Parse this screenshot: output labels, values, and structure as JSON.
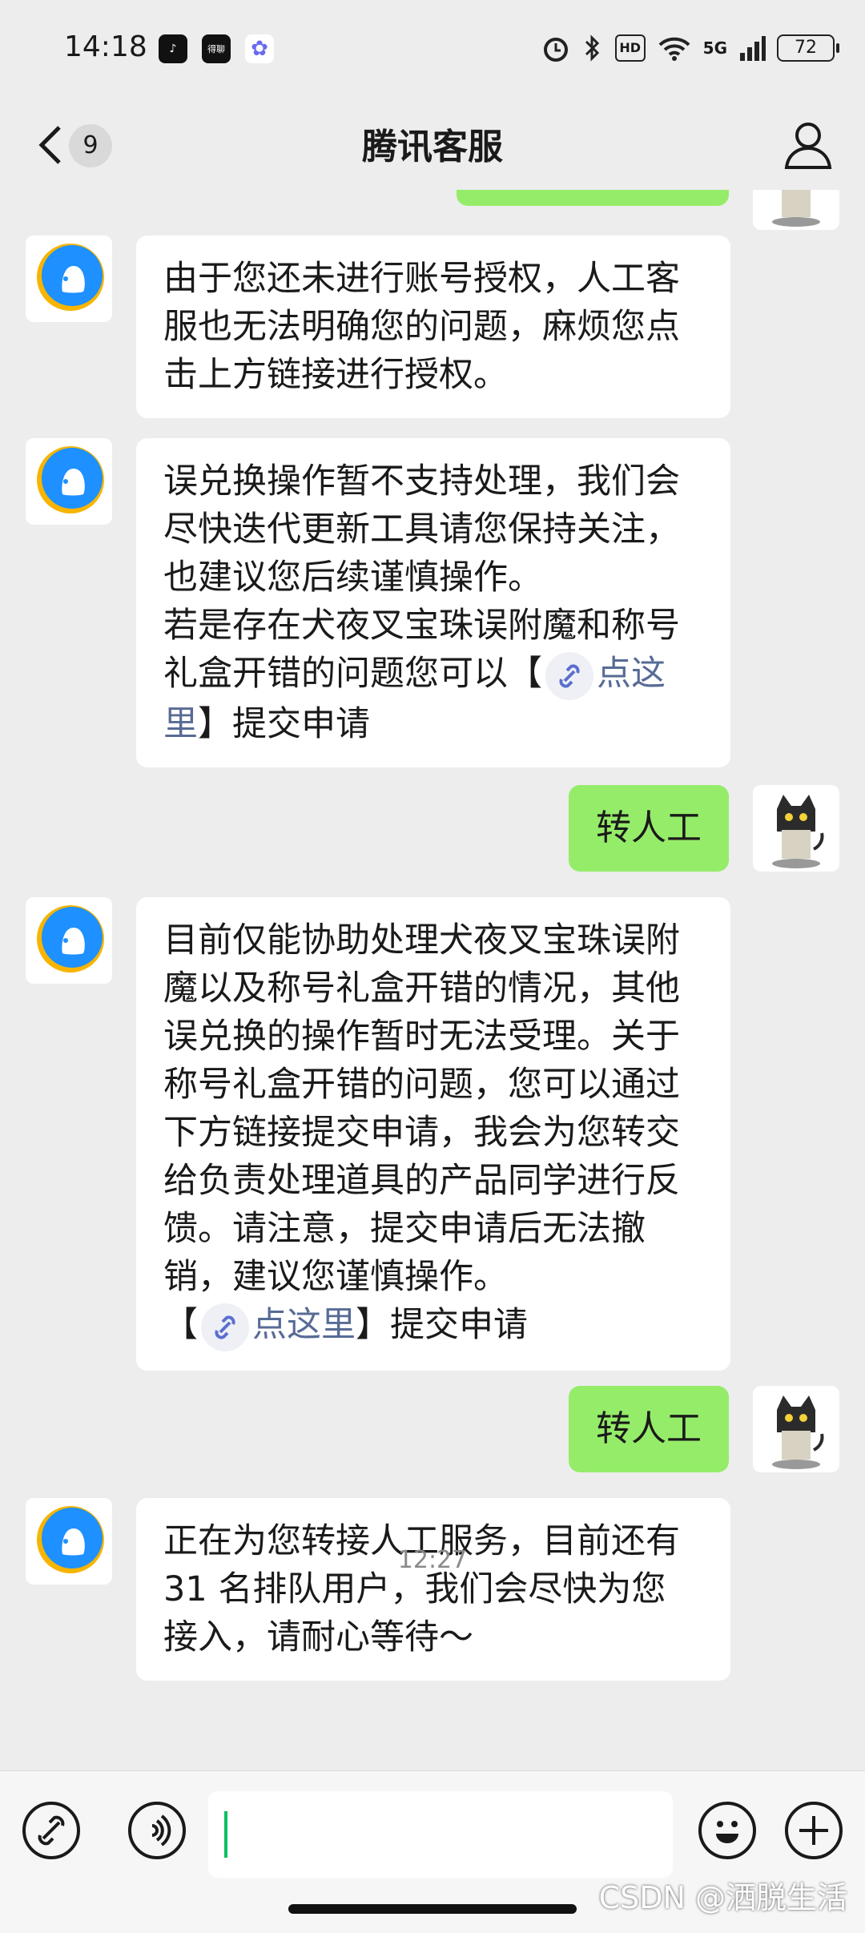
{
  "status": {
    "time": "14:18",
    "app_badges": [
      "♪",
      "得聊",
      "✿"
    ],
    "hd": "HD",
    "network": "5G",
    "battery": "72"
  },
  "header": {
    "back_count": "9",
    "title": "腾讯客服"
  },
  "messages": [
    {
      "from": "bot",
      "lines": [
        "由于您还未进行账号授权，人工客",
        "服也无法明确您的问题，麻烦您点",
        "击上方链接进行授权。"
      ]
    },
    {
      "from": "bot",
      "lines": [
        "误兑换操作暂不支持处理，我们会",
        "尽快迭代更新工具请您保持关注，",
        "也建议您后续谨慎操作。",
        "若是存在犬夜叉宝珠误附魔和称号"
      ],
      "link_prefix": "礼盒开错的问题您可以【",
      "link_text_1": "点这",
      "link_text_2": "里",
      "link_suffix": "】提交申请"
    },
    {
      "from": "user",
      "text": "转人工"
    },
    {
      "from": "bot",
      "lines": [
        "目前仅能协助处理犬夜叉宝珠误附",
        "魔以及称号礼盒开错的情况，其他",
        "误兑换的操作暂时无法受理。关于",
        "称号礼盒开错的问题，您可以通过",
        "下方链接提交申请，我会为您转交",
        "给负责处理道具的产品同学进行反",
        "馈。请注意，提交申请后无法撤",
        "销，建议您谨慎操作。"
      ],
      "link_prefix": "【",
      "link_text": "点这里",
      "link_suffix": "】提交申请"
    },
    {
      "from": "user",
      "text": "转人工"
    },
    {
      "from": "bot",
      "lines": [
        "正在为您转接人工服务，目前还有",
        "31 名排队用户，我们会尽快为您",
        "接入，请耐心等待～"
      ]
    }
  ],
  "timestamp": "12:27",
  "input": {
    "value": ""
  },
  "watermark": "CSDN @洒脱生活",
  "colors": {
    "user_bubble": "#95ec69",
    "link": "#576b95",
    "background": "#ededed"
  }
}
